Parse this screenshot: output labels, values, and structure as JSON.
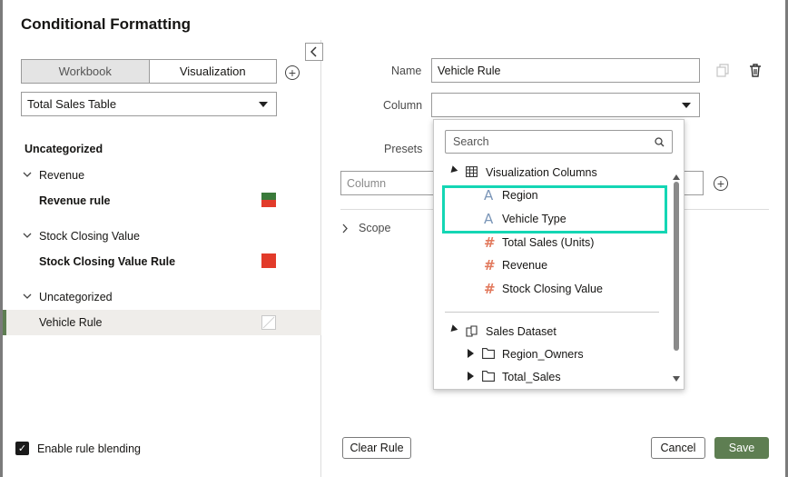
{
  "dialog": {
    "title": "Conditional Formatting"
  },
  "left": {
    "tabs": [
      "Workbook",
      "Visualization"
    ],
    "active_tab": "Visualization",
    "table_select": "Total Sales Table",
    "groups": [
      {
        "label": "Uncategorized"
      },
      {
        "label": "Revenue",
        "rule": "Revenue rule",
        "swatch_top": "#3a7a3a",
        "swatch_bottom": "#e23b2a"
      },
      {
        "label": "Stock Closing Value",
        "rule": "Stock Closing Value Rule",
        "swatch": "#e23b2a"
      },
      {
        "label": "Uncategorized",
        "rule": "Vehicle Rule"
      }
    ],
    "blending_label": "Enable rule blending",
    "blending_checked": true
  },
  "right": {
    "name_label": "Name",
    "name_value": "Vehicle Rule",
    "column_label": "Column",
    "column_value": "",
    "presets_label": "Presets",
    "condition_placeholder": "Column",
    "scope_label": "Scope"
  },
  "dropdown": {
    "search_placeholder": "Search",
    "viz_group": "Visualization Columns",
    "viz_items": [
      {
        "label": "Region",
        "type": "attribute"
      },
      {
        "label": "Vehicle Type",
        "type": "attribute"
      },
      {
        "label": "Total Sales (Units)",
        "type": "measure"
      },
      {
        "label": "Revenue",
        "type": "measure"
      },
      {
        "label": "Stock Closing Value",
        "type": "measure"
      }
    ],
    "dataset_group": "Sales Dataset",
    "dataset_items": [
      {
        "label": "Region_Owners"
      },
      {
        "label": "Total_Sales"
      }
    ],
    "highlight_color": "#14d6b4"
  },
  "footer": {
    "clear_label": "Clear Rule",
    "cancel_label": "Cancel",
    "save_label": "Save"
  },
  "colors": {
    "primary": "#5e7e52"
  }
}
